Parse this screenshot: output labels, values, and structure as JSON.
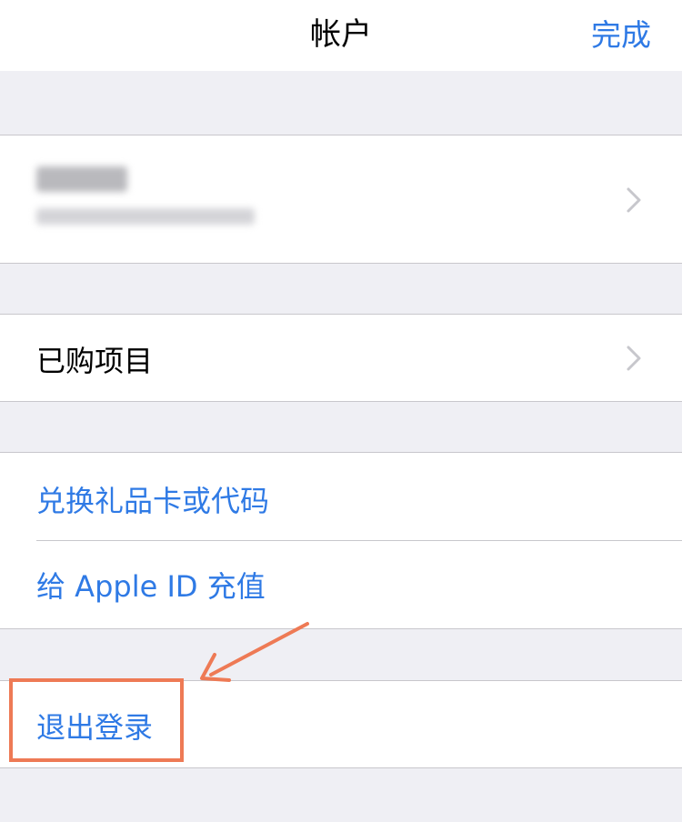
{
  "nav": {
    "title": "帐户",
    "done_label": "完成"
  },
  "rows": {
    "purchased": "已购项目",
    "redeem": "兑换礼品卡或代码",
    "add_funds": "给 Apple ID 充值",
    "sign_out": "退出登录"
  },
  "colors": {
    "accent": "#2f7ae5",
    "highlight": "#ee7a55",
    "background": "#efeff4"
  },
  "icons": {
    "chevron": "chevron-right-icon"
  }
}
